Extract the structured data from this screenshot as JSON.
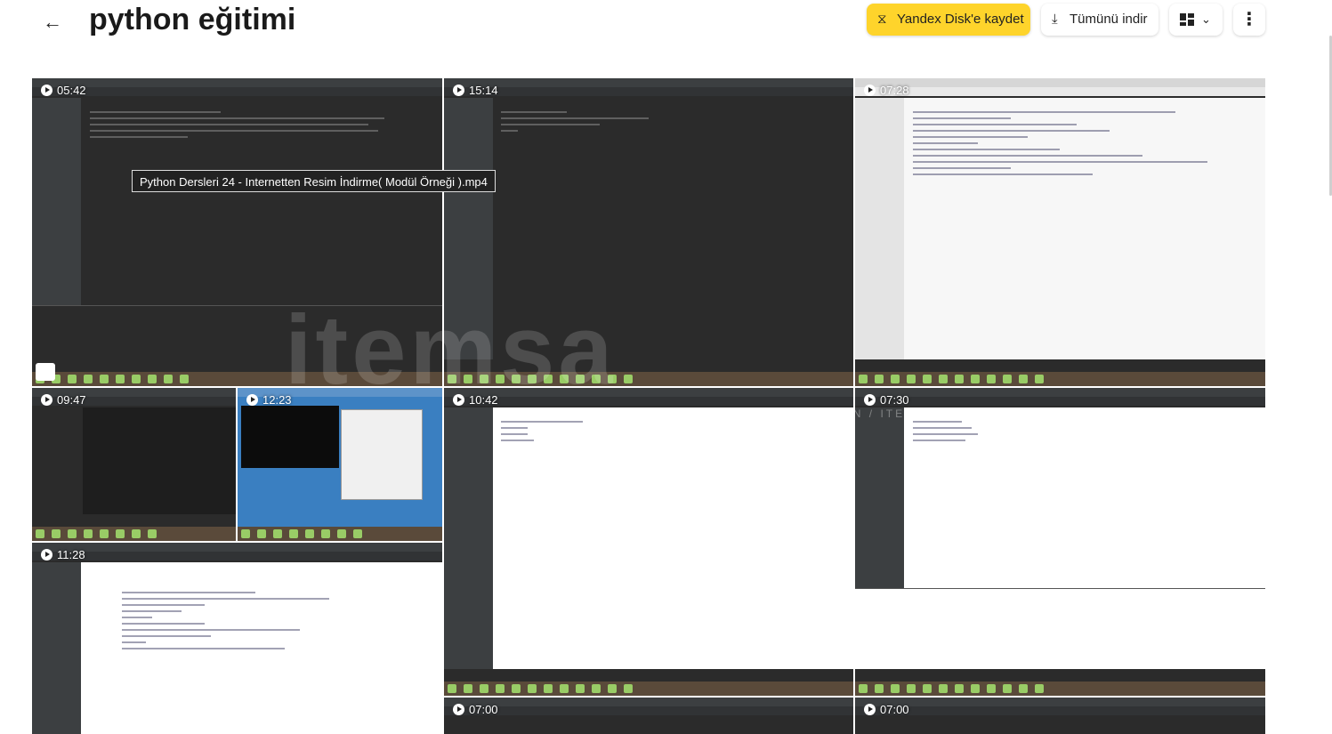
{
  "header": {
    "title": "python eğitimi",
    "save_label": "Yandex Disk'e kaydet",
    "download_label": "Tümünü indir",
    "accent": "#fed42b"
  },
  "tooltip": "Python Dersleri 24 - Internetten Resim İndirme( Modül Örneği ).mp4",
  "watermark": {
    "text": "itemsa",
    "sub": "HESAP / SKIN / ITEM / E-PIN"
  },
  "videos": [
    {
      "duration": "05:42"
    },
    {
      "duration": "15:14"
    },
    {
      "duration": "07:28"
    },
    {
      "duration": "09:47"
    },
    {
      "duration": "12:23"
    },
    {
      "duration": "10:42"
    },
    {
      "duration": "07:30"
    },
    {
      "duration": "11:28"
    },
    {
      "duration": "07:00"
    },
    {
      "duration": "07:00"
    }
  ]
}
